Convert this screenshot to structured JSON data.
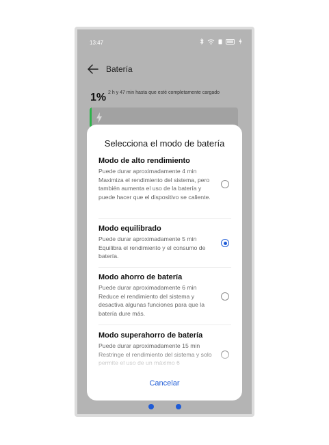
{
  "status_bar": {
    "time": "13:47",
    "icons": [
      "bluetooth-icon",
      "wifi-icon",
      "sim-icon",
      "battery-icon",
      "charging-icon"
    ]
  },
  "header": {
    "title": "Batería",
    "back_icon": "back-arrow-icon"
  },
  "battery": {
    "percent": "1%",
    "charge_text": "2 h y 47 min hasta que esté completamente cargado",
    "level": 0.01,
    "bar_color": "#2db34a"
  },
  "dialog": {
    "title": "Selecciona el modo de batería",
    "options": [
      {
        "title": "Modo de alto rendimiento",
        "description": "Puede durar aproximadamente 4 min Maximiza el rendimiento del sistema, pero también aumenta el uso de la batería y puede hacer que el dispositivo se caliente.",
        "selected": false
      },
      {
        "title": "Modo equilibrado",
        "description": "Puede durar aproximadamente 5 min Equilibra el rendimiento y el consumo de batería.",
        "selected": true
      },
      {
        "title": "Modo ahorro de batería",
        "description": "Puede durar aproximadamente 6 min Reduce el rendimiento del sistema y desactiva algunas funciones para que la batería dure más.",
        "selected": false
      },
      {
        "title": "Modo superahorro de batería",
        "description": "Puede durar aproximadamente 15 min Restringe el rendimiento del sistema y solo permite el uso de un máximo 6",
        "selected": false
      }
    ],
    "cancel_label": "Cancelar"
  },
  "colors": {
    "accent": "#1e5bd6",
    "overlay": "#b4b4b4",
    "sheet": "#ffffff"
  }
}
